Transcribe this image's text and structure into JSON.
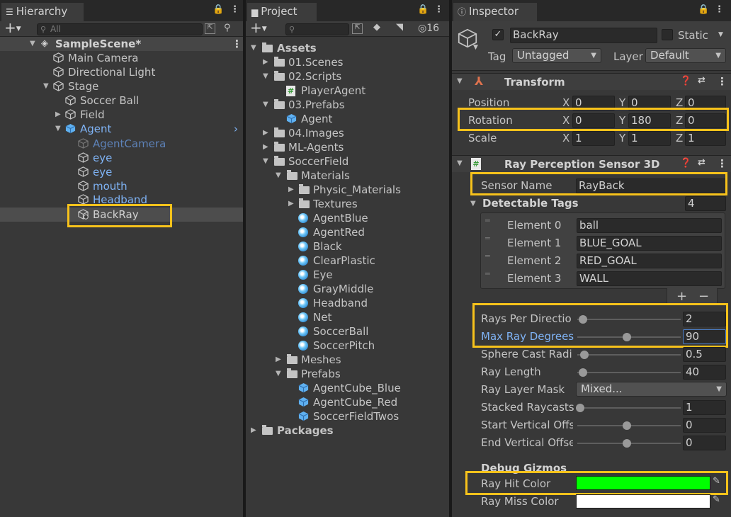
{
  "hierarchy": {
    "tab": "Hierarchy",
    "search_placeholder": "All",
    "add": "+",
    "scene": "SampleScene*",
    "items": [
      "Main Camera",
      "Directional Light",
      "Stage",
      "Soccer Ball",
      "Field",
      "Agent",
      "AgentCamera",
      "eye",
      "eye",
      "mouth",
      "Headband",
      "BackRay"
    ]
  },
  "project": {
    "tab": "Project",
    "add": "+",
    "hidden_count": "16",
    "items": [
      "Assets",
      "01.Scenes",
      "02.Scripts",
      "PlayerAgent",
      "03.Prefabs",
      "Agent",
      "04.Images",
      "ML-Agents",
      "SoccerField",
      "Materials",
      "Physic_Materials",
      "Textures",
      "AgentBlue",
      "AgentRed",
      "Black",
      "ClearPlastic",
      "Eye",
      "GrayMiddle",
      "Headband",
      "Net",
      "SoccerBall",
      "SoccerPitch",
      "Meshes",
      "Prefabs",
      "AgentCube_Blue",
      "AgentCube_Red",
      "SoccerFieldTwos",
      "Packages"
    ]
  },
  "inspector": {
    "tab": "Inspector",
    "object_name": "BackRay",
    "static_label": "Static",
    "tag_label": "Tag",
    "tag_value": "Untagged",
    "layer_label": "Layer",
    "layer_value": "Default",
    "transform": {
      "title": "Transform",
      "position": {
        "label": "Position",
        "x": "0",
        "y": "0",
        "z": "0"
      },
      "rotation": {
        "label": "Rotation",
        "x": "0",
        "y": "180",
        "z": "0"
      },
      "scale": {
        "label": "Scale",
        "x": "1",
        "y": "1",
        "z": "1"
      },
      "axis_x": "X",
      "axis_y": "Y",
      "axis_z": "Z"
    },
    "sensor": {
      "title": "Ray Perception Sensor 3D",
      "sensor_name_label": "Sensor Name",
      "sensor_name": "RayBack",
      "tags_label": "Detectable Tags",
      "tags_count": "4",
      "elements": [
        {
          "label": "Element 0",
          "value": "ball"
        },
        {
          "label": "Element 1",
          "value": "BLUE_GOAL"
        },
        {
          "label": "Element 2",
          "value": "RED_GOAL"
        },
        {
          "label": "Element 3",
          "value": "WALL"
        }
      ],
      "plus": "+",
      "minus": "−",
      "rays_label": "Rays Per Directio",
      "rays": "2",
      "maxdeg_label": "Max Ray Degrees",
      "maxdeg": "90",
      "sphere_label": "Sphere Cast Radiu",
      "sphere": "0.5",
      "length_label": "Ray Length",
      "length": "40",
      "mask_label": "Ray Layer Mask",
      "mask": "Mixed...",
      "stacked_label": "Stacked Raycasts",
      "stacked": "1",
      "startv_label": "Start Vertical Offse",
      "startv": "0",
      "endv_label": "End Vertical Offse",
      "endv": "0",
      "gizmos_label": "Debug Gizmos",
      "hit_label": "Ray Hit Color",
      "miss_label": "Ray Miss Color"
    }
  },
  "colors": {
    "highlight": "#f7c21b",
    "selected_blue": "#4c7fc9",
    "hit_color": "#00ff00",
    "miss_color": "#ffffff"
  }
}
